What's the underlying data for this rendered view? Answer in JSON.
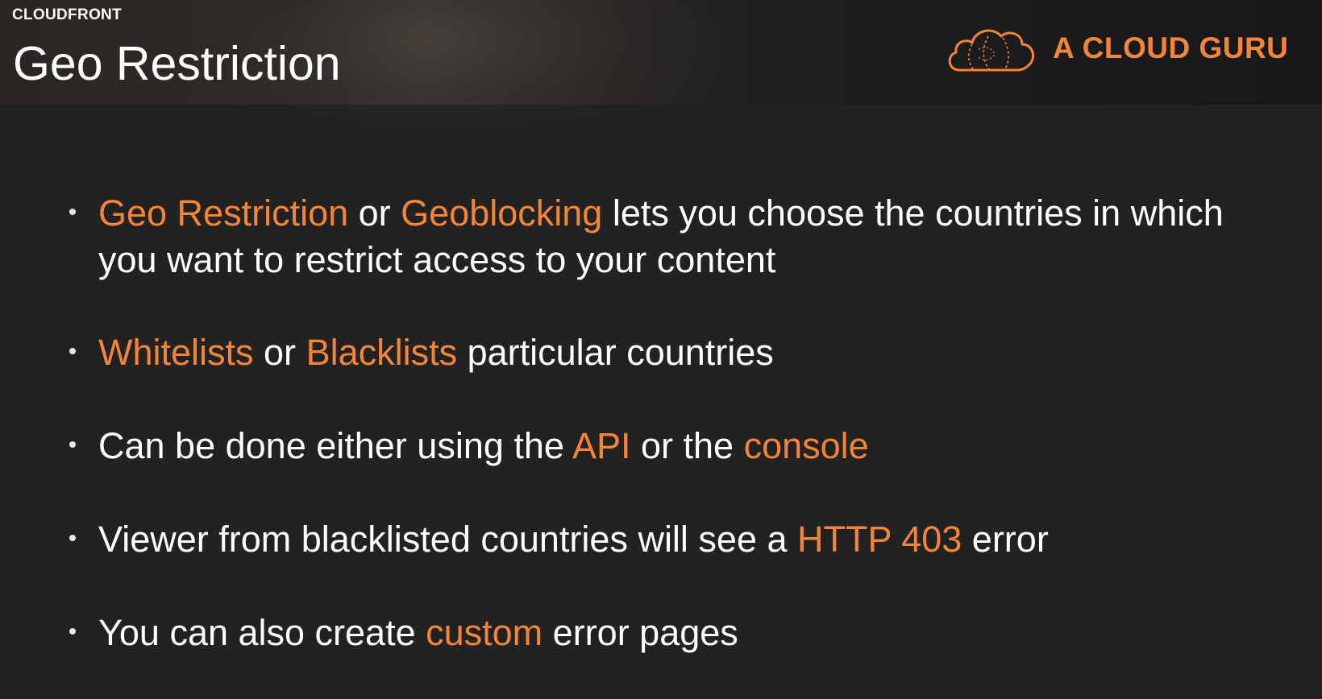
{
  "header": {
    "section_label": "CLOUDFRONT",
    "title": "Geo Restriction",
    "logo": {
      "icon": "cloud-icon",
      "text": "A CLOUD GURU"
    }
  },
  "colors": {
    "accent": "#f58536",
    "text": "#ffffff",
    "background": "#222222"
  },
  "bullets": [
    {
      "p1": "Geo Restriction",
      "p2": " or ",
      "p3": "Geoblocking",
      "p4": " lets you choose the countries in which you want to restrict access to your content"
    },
    {
      "p1": "Whitelists",
      "p2": " or ",
      "p3": "Blacklists",
      "p4": " particular countries"
    },
    {
      "p1": "Can be done either using the ",
      "p2": "API",
      "p3": " or the ",
      "p4": "console"
    },
    {
      "p1": "Viewer from blacklisted countries will see a ",
      "p2": "HTTP 403",
      "p3": " error"
    },
    {
      "p1": "You can also create ",
      "p2": "custom",
      "p3": " error pages"
    }
  ]
}
